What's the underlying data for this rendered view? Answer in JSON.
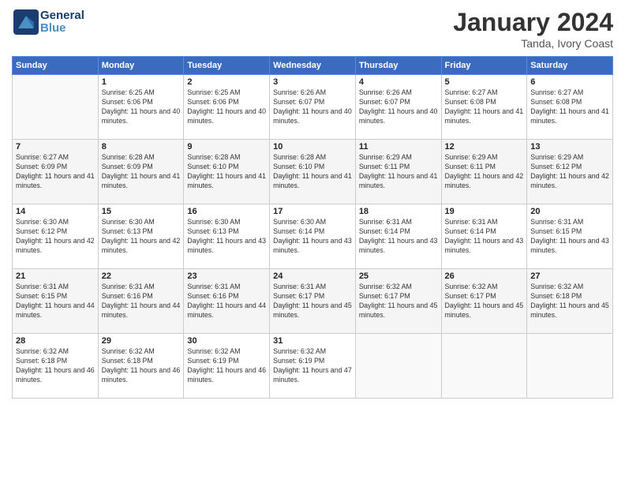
{
  "header": {
    "logo_line1": "General",
    "logo_line2": "Blue",
    "month": "January 2024",
    "location": "Tanda, Ivory Coast"
  },
  "days_of_week": [
    "Sunday",
    "Monday",
    "Tuesday",
    "Wednesday",
    "Thursday",
    "Friday",
    "Saturday"
  ],
  "weeks": [
    [
      {
        "day": "",
        "sunrise": "",
        "sunset": "",
        "daylight": ""
      },
      {
        "day": "1",
        "sunrise": "Sunrise: 6:25 AM",
        "sunset": "Sunset: 6:06 PM",
        "daylight": "Daylight: 11 hours and 40 minutes."
      },
      {
        "day": "2",
        "sunrise": "Sunrise: 6:25 AM",
        "sunset": "Sunset: 6:06 PM",
        "daylight": "Daylight: 11 hours and 40 minutes."
      },
      {
        "day": "3",
        "sunrise": "Sunrise: 6:26 AM",
        "sunset": "Sunset: 6:07 PM",
        "daylight": "Daylight: 11 hours and 40 minutes."
      },
      {
        "day": "4",
        "sunrise": "Sunrise: 6:26 AM",
        "sunset": "Sunset: 6:07 PM",
        "daylight": "Daylight: 11 hours and 40 minutes."
      },
      {
        "day": "5",
        "sunrise": "Sunrise: 6:27 AM",
        "sunset": "Sunset: 6:08 PM",
        "daylight": "Daylight: 11 hours and 41 minutes."
      },
      {
        "day": "6",
        "sunrise": "Sunrise: 6:27 AM",
        "sunset": "Sunset: 6:08 PM",
        "daylight": "Daylight: 11 hours and 41 minutes."
      }
    ],
    [
      {
        "day": "7",
        "sunrise": "Sunrise: 6:27 AM",
        "sunset": "Sunset: 6:09 PM",
        "daylight": "Daylight: 11 hours and 41 minutes."
      },
      {
        "day": "8",
        "sunrise": "Sunrise: 6:28 AM",
        "sunset": "Sunset: 6:09 PM",
        "daylight": "Daylight: 11 hours and 41 minutes."
      },
      {
        "day": "9",
        "sunrise": "Sunrise: 6:28 AM",
        "sunset": "Sunset: 6:10 PM",
        "daylight": "Daylight: 11 hours and 41 minutes."
      },
      {
        "day": "10",
        "sunrise": "Sunrise: 6:28 AM",
        "sunset": "Sunset: 6:10 PM",
        "daylight": "Daylight: 11 hours and 41 minutes."
      },
      {
        "day": "11",
        "sunrise": "Sunrise: 6:29 AM",
        "sunset": "Sunset: 6:11 PM",
        "daylight": "Daylight: 11 hours and 41 minutes."
      },
      {
        "day": "12",
        "sunrise": "Sunrise: 6:29 AM",
        "sunset": "Sunset: 6:11 PM",
        "daylight": "Daylight: 11 hours and 42 minutes."
      },
      {
        "day": "13",
        "sunrise": "Sunrise: 6:29 AM",
        "sunset": "Sunset: 6:12 PM",
        "daylight": "Daylight: 11 hours and 42 minutes."
      }
    ],
    [
      {
        "day": "14",
        "sunrise": "Sunrise: 6:30 AM",
        "sunset": "Sunset: 6:12 PM",
        "daylight": "Daylight: 11 hours and 42 minutes."
      },
      {
        "day": "15",
        "sunrise": "Sunrise: 6:30 AM",
        "sunset": "Sunset: 6:13 PM",
        "daylight": "Daylight: 11 hours and 42 minutes."
      },
      {
        "day": "16",
        "sunrise": "Sunrise: 6:30 AM",
        "sunset": "Sunset: 6:13 PM",
        "daylight": "Daylight: 11 hours and 43 minutes."
      },
      {
        "day": "17",
        "sunrise": "Sunrise: 6:30 AM",
        "sunset": "Sunset: 6:14 PM",
        "daylight": "Daylight: 11 hours and 43 minutes."
      },
      {
        "day": "18",
        "sunrise": "Sunrise: 6:31 AM",
        "sunset": "Sunset: 6:14 PM",
        "daylight": "Daylight: 11 hours and 43 minutes."
      },
      {
        "day": "19",
        "sunrise": "Sunrise: 6:31 AM",
        "sunset": "Sunset: 6:14 PM",
        "daylight": "Daylight: 11 hours and 43 minutes."
      },
      {
        "day": "20",
        "sunrise": "Sunrise: 6:31 AM",
        "sunset": "Sunset: 6:15 PM",
        "daylight": "Daylight: 11 hours and 43 minutes."
      }
    ],
    [
      {
        "day": "21",
        "sunrise": "Sunrise: 6:31 AM",
        "sunset": "Sunset: 6:15 PM",
        "daylight": "Daylight: 11 hours and 44 minutes."
      },
      {
        "day": "22",
        "sunrise": "Sunrise: 6:31 AM",
        "sunset": "Sunset: 6:16 PM",
        "daylight": "Daylight: 11 hours and 44 minutes."
      },
      {
        "day": "23",
        "sunrise": "Sunrise: 6:31 AM",
        "sunset": "Sunset: 6:16 PM",
        "daylight": "Daylight: 11 hours and 44 minutes."
      },
      {
        "day": "24",
        "sunrise": "Sunrise: 6:31 AM",
        "sunset": "Sunset: 6:17 PM",
        "daylight": "Daylight: 11 hours and 45 minutes."
      },
      {
        "day": "25",
        "sunrise": "Sunrise: 6:32 AM",
        "sunset": "Sunset: 6:17 PM",
        "daylight": "Daylight: 11 hours and 45 minutes."
      },
      {
        "day": "26",
        "sunrise": "Sunrise: 6:32 AM",
        "sunset": "Sunset: 6:17 PM",
        "daylight": "Daylight: 11 hours and 45 minutes."
      },
      {
        "day": "27",
        "sunrise": "Sunrise: 6:32 AM",
        "sunset": "Sunset: 6:18 PM",
        "daylight": "Daylight: 11 hours and 45 minutes."
      }
    ],
    [
      {
        "day": "28",
        "sunrise": "Sunrise: 6:32 AM",
        "sunset": "Sunset: 6:18 PM",
        "daylight": "Daylight: 11 hours and 46 minutes."
      },
      {
        "day": "29",
        "sunrise": "Sunrise: 6:32 AM",
        "sunset": "Sunset: 6:18 PM",
        "daylight": "Daylight: 11 hours and 46 minutes."
      },
      {
        "day": "30",
        "sunrise": "Sunrise: 6:32 AM",
        "sunset": "Sunset: 6:19 PM",
        "daylight": "Daylight: 11 hours and 46 minutes."
      },
      {
        "day": "31",
        "sunrise": "Sunrise: 6:32 AM",
        "sunset": "Sunset: 6:19 PM",
        "daylight": "Daylight: 11 hours and 47 minutes."
      },
      {
        "day": "",
        "sunrise": "",
        "sunset": "",
        "daylight": ""
      },
      {
        "day": "",
        "sunrise": "",
        "sunset": "",
        "daylight": ""
      },
      {
        "day": "",
        "sunrise": "",
        "sunset": "",
        "daylight": ""
      }
    ]
  ]
}
